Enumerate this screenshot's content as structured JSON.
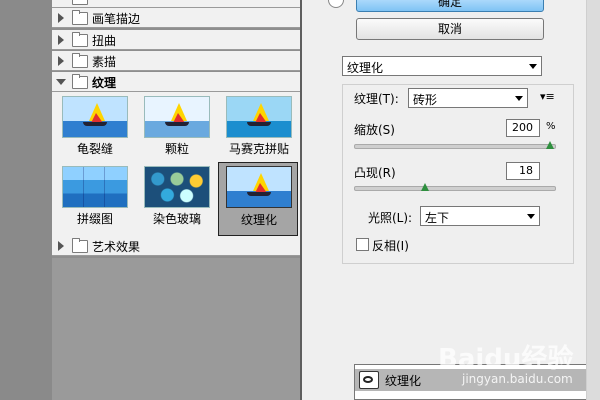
{
  "filter_gallery": {
    "categories": [
      {
        "label": "画笔描边"
      },
      {
        "label": "扭曲"
      },
      {
        "label": "素描"
      },
      {
        "label": "纹理"
      },
      {
        "label": "艺术效果"
      }
    ],
    "texture_filters": [
      {
        "label": "龟裂缝"
      },
      {
        "label": "颗粒"
      },
      {
        "label": "马赛克拼贴"
      },
      {
        "label": "拼缀图"
      },
      {
        "label": "染色玻璃"
      },
      {
        "label": "纹理化"
      }
    ],
    "selected_filter": "纹理化"
  },
  "buttons": {
    "ok": "确定",
    "cancel": "取消"
  },
  "settings": {
    "filter_select": "纹理化",
    "texture_label": "纹理(T):",
    "texture_value": "砖形",
    "scale_label": "缩放(S)",
    "scale_value": "200",
    "scale_unit": "%",
    "scale_level_percent": 100,
    "relief_label": "凸现(R)",
    "relief_value": "18",
    "relief_level_percent": 36,
    "light_label": "光照(L):",
    "light_value": "左下",
    "invert_label": "反相(I)",
    "invert_checked": false
  },
  "layers": {
    "items": [
      {
        "label": "纹理化"
      }
    ]
  },
  "watermark": {
    "brand": "Baidu经验",
    "url": "jingyan.baidu.com"
  },
  "icons": {
    "expand": "triangle-right-icon",
    "collapse": "triangle-down-icon",
    "folder": "folder-icon",
    "menu": "panel-menu-icon",
    "eye": "eye-icon"
  }
}
